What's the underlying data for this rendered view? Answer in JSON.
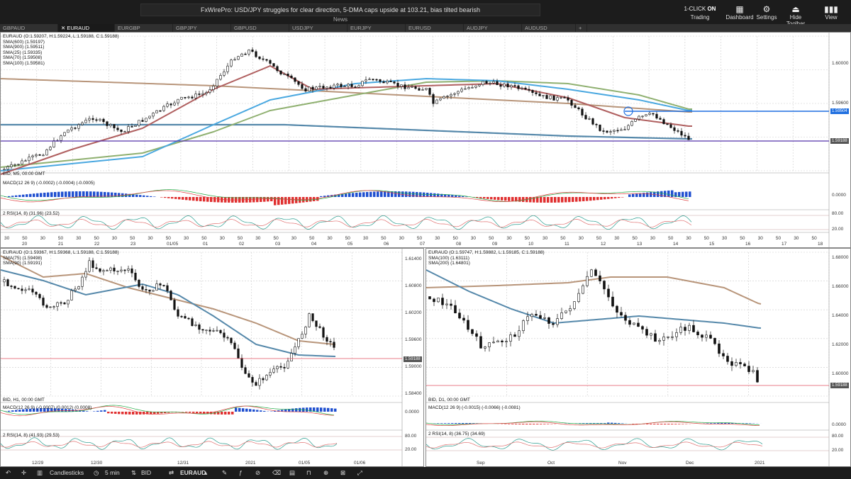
{
  "topbar": {
    "news_text": "FxWirePro: USD/JPY struggles for clear direction, 5-DMA caps upside at 103.21, bias tilted bearish",
    "news_label": "News",
    "one_click": "1-CLICK",
    "one_click_state": "ON",
    "trading": "Trading",
    "dashboard": "Dashboard",
    "settings": "Settings",
    "hide_toolbar": "Hide Toolbar",
    "view": "View"
  },
  "tabs": [
    "GBPAUD",
    "EURAUD",
    "EURGBP",
    "GBPJPY",
    "GBPUSD",
    "USDJPY",
    "EURJPY",
    "EURUSD",
    "AUDJPY",
    "AUDUSD"
  ],
  "tab_add": "+",
  "top_chart": {
    "legend": [
      "EURAUD (O:1.59207, H:1.59224, L:1.59188, C:1.59188)",
      "SMA(600) (1.59197)",
      "SMA(900) (1.59511)",
      "SMA(25) (1.59335)",
      "SMA(70) (1.59508)",
      "SMA(100) (1.59581)"
    ],
    "bid": "BID, M5, 00:00 GMT",
    "macd": "MACD(12 26 9) (-0.0002) (-0.0004) (-0.0005)",
    "rsi": "2 RSI(14, 8) (31.96) (23.52)",
    "y_ticks": [
      "1.60000",
      "1.59600"
    ],
    "tag_blue": "1.59504",
    "tag_red": "1.59188",
    "macd_tick": "0.0000",
    "rsi_ticks": [
      "80.00",
      "20.00"
    ],
    "x_labels": [
      "20",
      "21",
      "22",
      "23",
      "01/05",
      "01",
      "02",
      "03",
      "04",
      "05",
      "06",
      "07",
      "08",
      "09",
      "10",
      "11",
      "12",
      "13",
      "14",
      "15",
      "16",
      "17",
      "18"
    ]
  },
  "left_chart": {
    "legend": [
      "EURAUD (O:1.59367, H:1.59368, L:1.59188, C:1.59188)",
      "SMA(75) (1.59498)",
      "SMA(90) (1.59191)"
    ],
    "bid": "BID, H1, 00:00 GMT",
    "macd": "MACD(12 26 9) (-0.0007) (0.0012) (0.0008)",
    "rsi": "2 RSI(14, 8) (41.93) (29.53)",
    "y_ticks": [
      "1.61400",
      "1.60800",
      "1.60200",
      "1.59600",
      "1.59000",
      "1.58400"
    ],
    "tag_red": "1.59188",
    "macd_tick": "0.0000",
    "rsi_ticks": [
      "80.00",
      "20.00"
    ],
    "x_labels": [
      "12/29",
      "12/30",
      "12/31",
      "2021",
      "01/05",
      "01/06"
    ]
  },
  "right_chart": {
    "legend": [
      "EURAUD (O:1.59747, H:1.59882, L:1.59185, C:1.59188)",
      "SMA(100) (1.63111)",
      "SMA(200) (1.64801)"
    ],
    "bid": "BID, D1, 00:00 GMT",
    "macd": "MACD(12 26 9) (-0.0015) (-0.0066) (-0.0081)",
    "rsi": "2 RSI(14, 8) (36.75) (34.69)",
    "y_ticks": [
      "1.68000",
      "1.66000",
      "1.64000",
      "1.62000",
      "1.60000"
    ],
    "tag_red": "1.59188",
    "macd_tick": "0.0000",
    "rsi_ticks": [
      "80.00",
      "20.00"
    ],
    "x_labels": [
      "Sep",
      "Oct",
      "Nov",
      "Dec",
      "2021"
    ]
  },
  "bottombar": {
    "chart_type": "Candlesticks",
    "interval": "5 min",
    "price_type": "BID",
    "symbol": "EURAUD"
  },
  "colors": {
    "sma_blue": "#4aa8e0",
    "sma_red": "#b06060",
    "sma_green": "#8fb070",
    "sma_tan": "#b8957a",
    "sma_slate": "#5588aa",
    "hline_blue": "#1f6fe0",
    "hline_purple": "#5533aa",
    "hline_red": "#e05060"
  }
}
